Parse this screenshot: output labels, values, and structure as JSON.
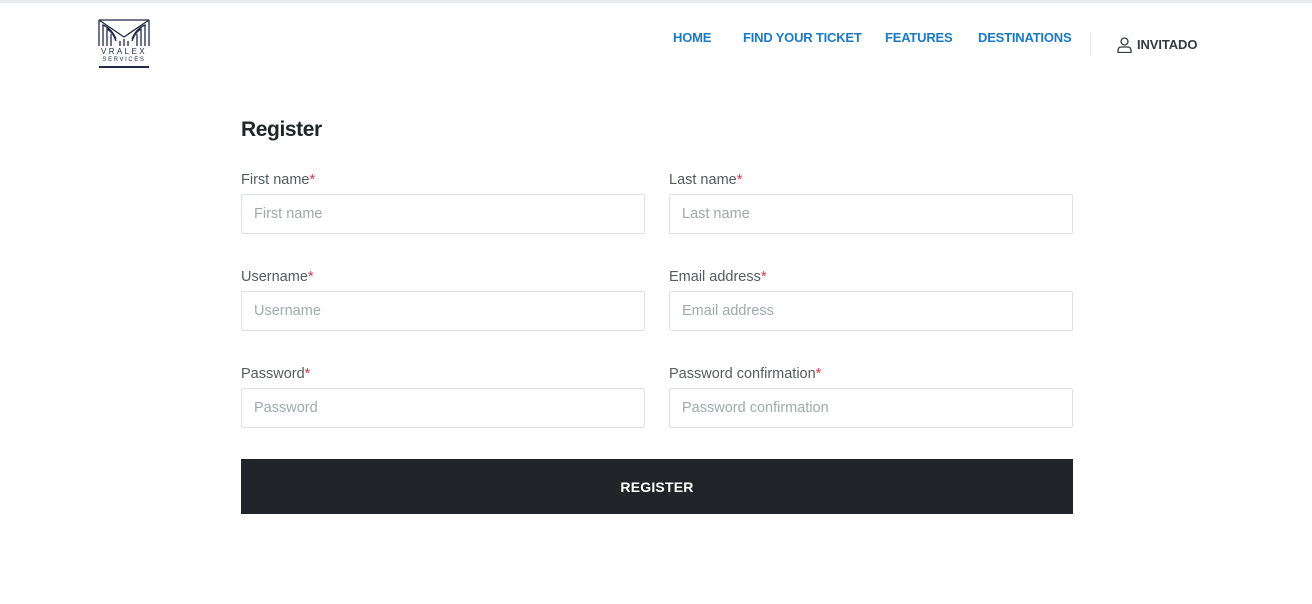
{
  "brand": {
    "line1": "VRALEX",
    "line2": "SERVICES",
    "color": "#1f2a44"
  },
  "nav": {
    "links": [
      "HOME",
      "FIND YOUR TICKET",
      "FEATURES",
      "DESTINATIONS"
    ],
    "user_label": "INVITADO",
    "user_icon": "user-icon",
    "link_color": "#1a7ac4"
  },
  "form": {
    "title": "Register",
    "required_marker": "*",
    "fields": {
      "first_name": {
        "label": "First name",
        "placeholder": "First name"
      },
      "last_name": {
        "label": "Last name",
        "placeholder": "Last name"
      },
      "username": {
        "label": "Username",
        "placeholder": "Username"
      },
      "email": {
        "label": "Email address",
        "placeholder": "Email address"
      },
      "password": {
        "label": "Password",
        "placeholder": "Password"
      },
      "password_confirmation": {
        "label": "Password confirmation",
        "placeholder": "Password confirmation"
      }
    },
    "submit_label": "REGISTER",
    "button_color": "#212529",
    "required_color": "#dc3545"
  }
}
